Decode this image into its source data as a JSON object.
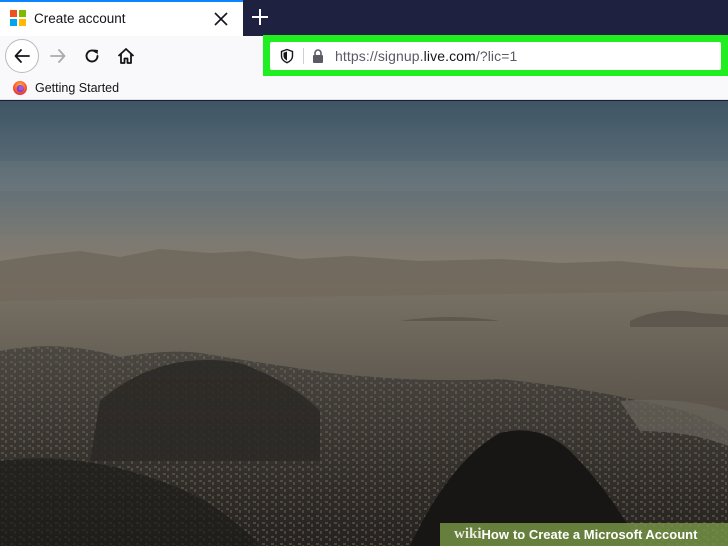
{
  "tab": {
    "title": "Create account",
    "favicon": "microsoft-logo-icon",
    "close_icon": "close-icon",
    "active_color": "#0a84ff"
  },
  "toolbar": {
    "new_tab_icon": "plus-icon",
    "back_icon": "arrow-left-icon",
    "forward_icon": "arrow-right-icon",
    "reload_icon": "reload-icon",
    "home_icon": "home-icon"
  },
  "urlbar": {
    "scheme_and_sub": "https://signup.",
    "domain": "live.com",
    "path": "/?lic=1",
    "highlight_color": "#21ee21"
  },
  "bookmarks": {
    "items": [
      {
        "label": "Getting Started",
        "icon": "firefox-icon"
      }
    ]
  },
  "watermark": {
    "logo": "wiki",
    "how": "How",
    "rest": "to Create a Microsoft Account"
  },
  "colors": {
    "tabstrip_bg": "#1e2140",
    "toolbar_bg": "#f9f9fb",
    "ms_red": "#f25022",
    "ms_green": "#7fba00",
    "ms_blue": "#00a4ef",
    "ms_yellow": "#ffb900"
  }
}
